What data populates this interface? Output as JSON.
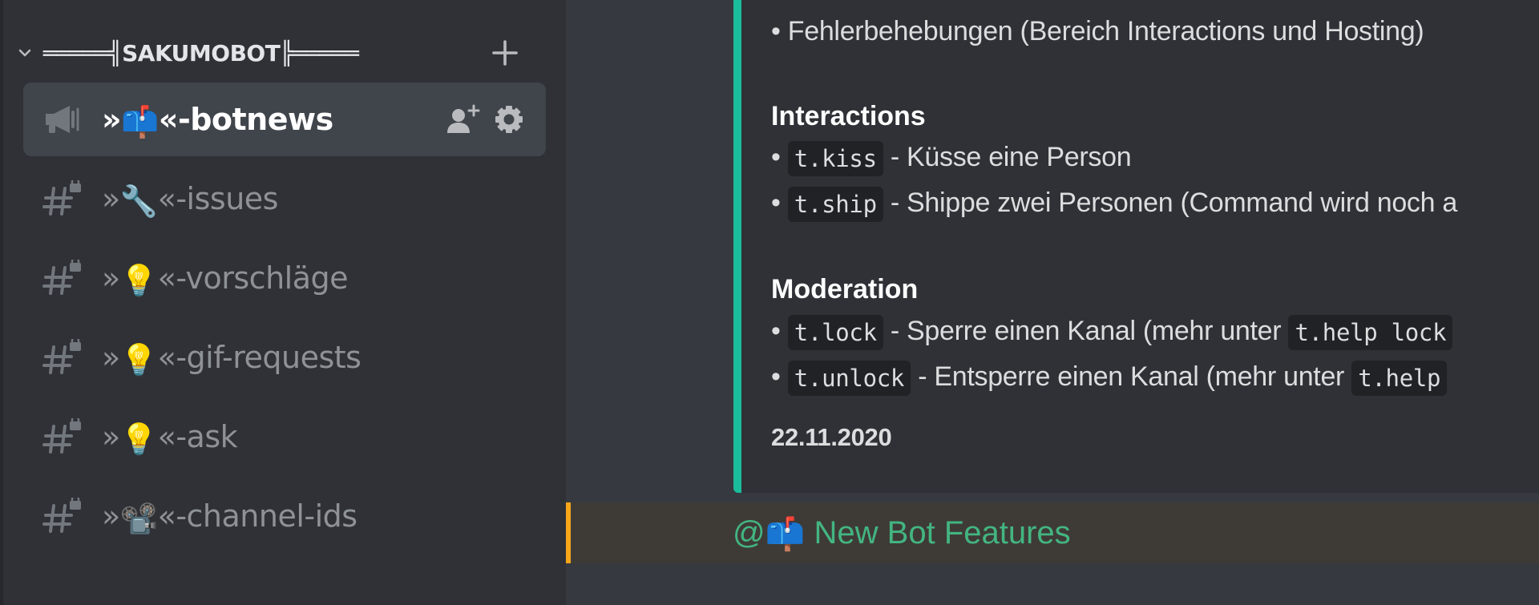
{
  "sidebar": {
    "category": {
      "name": "═════╣SAKUMOBOT╠═════",
      "collapse_icon": "chevron-down-icon",
      "add_icon": "plus-icon"
    },
    "channels": [
      {
        "prefix": "»",
        "emoji": "📫",
        "suffix": "«-botnews",
        "type": "announcement",
        "active": true,
        "icon": "megaphone-icon"
      },
      {
        "prefix": "»",
        "emoji": "🔧",
        "suffix": "«-issues",
        "type": "text-locked",
        "active": false,
        "icon": "locked-hash-icon"
      },
      {
        "prefix": "»",
        "emoji": "💡",
        "suffix": "«-vorschläge",
        "type": "text-locked",
        "active": false,
        "icon": "locked-hash-icon"
      },
      {
        "prefix": "»",
        "emoji": "💡",
        "suffix": "«-gif-requests",
        "type": "text-locked",
        "active": false,
        "icon": "locked-hash-icon"
      },
      {
        "prefix": "»",
        "emoji": "💡",
        "suffix": "«-ask",
        "type": "text-locked",
        "active": false,
        "icon": "locked-hash-icon"
      },
      {
        "prefix": "»",
        "emoji": "📽️",
        "suffix": "«-channel-ids",
        "type": "text-locked",
        "active": false,
        "icon": "locked-hash-icon"
      }
    ],
    "active_channel_actions": [
      "add-member-icon",
      "gear-icon"
    ]
  },
  "embed": {
    "accent_color": "#1abc9c",
    "top_line": "• Fehlerbehebungen (Bereich Interactions und Hosting)",
    "sections": [
      {
        "heading": "Interactions",
        "items": [
          {
            "bullet": "•",
            "code": "t.kiss",
            "text": " - Küsse eine Person"
          },
          {
            "bullet": "•",
            "code": "t.ship",
            "text": " - Shippe zwei Personen (Command wird noch a"
          }
        ]
      },
      {
        "heading": "Moderation",
        "items": [
          {
            "bullet": "•",
            "code": "t.lock",
            "text": " - Sperre einen Kanal (mehr unter ",
            "code2": "t.help lock"
          },
          {
            "bullet": "•",
            "code": "t.unlock",
            "text": " - Entsperre einen Kanal (mehr unter ",
            "code2": "t.help"
          }
        ]
      }
    ],
    "date": "22.11.2020"
  },
  "mention": {
    "at": "@",
    "emoji": "📫",
    "text": " New Bot Features",
    "color": "#43b581",
    "highlight_color": "#faa61a"
  }
}
